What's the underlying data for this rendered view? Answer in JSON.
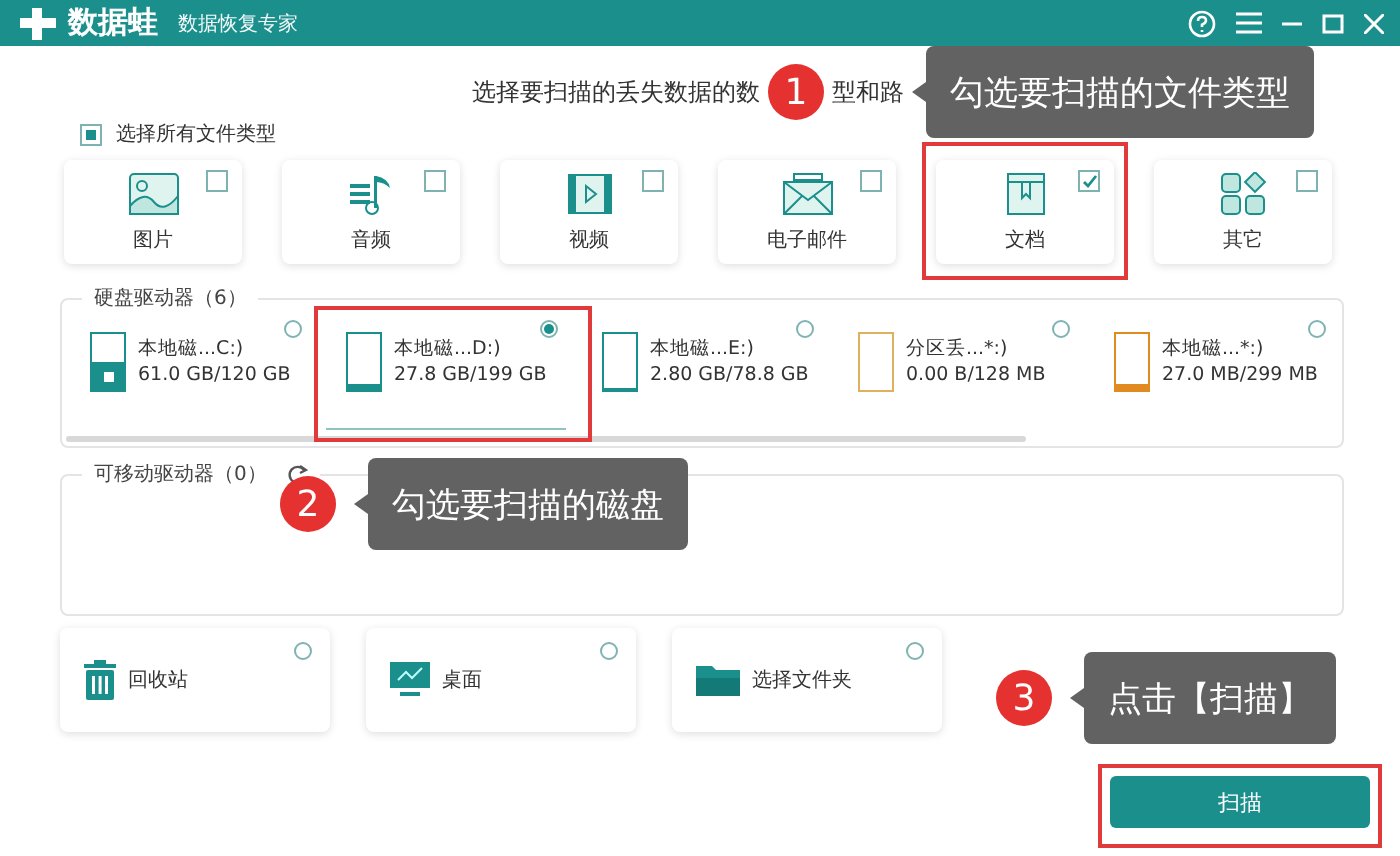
{
  "window": {
    "app_name": "数据蛙",
    "subtitle": "数据恢复专家"
  },
  "heading": "选择要扫描的丢失数据的数",
  "heading_tail": "型和路",
  "select_all": {
    "label": "选择所有文件类型",
    "checked": true
  },
  "file_types": [
    {
      "label": "图片",
      "kind": "image",
      "checked": false
    },
    {
      "label": "音频",
      "kind": "audio",
      "checked": false
    },
    {
      "label": "视频",
      "kind": "video",
      "checked": false
    },
    {
      "label": "电子邮件",
      "kind": "email",
      "checked": false
    },
    {
      "label": "文档",
      "kind": "document",
      "checked": true
    },
    {
      "label": "其它",
      "kind": "other",
      "checked": false
    }
  ],
  "hard_drives": {
    "title": "硬盘驱动器（6）",
    "drives": [
      {
        "name": "本地磁...C:)",
        "usage": "61.0 GB/120 GB",
        "kind": "system",
        "level": 0.5,
        "color": "#1a8f8c",
        "selected": false
      },
      {
        "name": "本地磁...D:)",
        "usage": "27.8 GB/199 GB",
        "kind": "disk",
        "level": 0.12,
        "color": "#1a8f8c",
        "selected": true
      },
      {
        "name": "本地磁...E:)",
        "usage": "2.80 GB/78.8 GB",
        "kind": "disk",
        "level": 0.04,
        "color": "#1a8f8c",
        "selected": false
      },
      {
        "name": "分区丢...*:)",
        "usage": "0.00  B/128 MB",
        "kind": "disk",
        "level": 0,
        "color": "#e0b060",
        "selected": false
      },
      {
        "name": "本地磁...*:)",
        "usage": "27.0 MB/299 MB",
        "kind": "disk",
        "level": 0.12,
        "color": "#e08a20",
        "selected": false
      }
    ]
  },
  "removable_drives": {
    "title": "可移动驱动器（0）"
  },
  "locations": [
    {
      "label": "回收站",
      "kind": "trash",
      "selected": false
    },
    {
      "label": "桌面",
      "kind": "desktop",
      "selected": false
    },
    {
      "label": "选择文件夹",
      "kind": "folder",
      "selected": false
    }
  ],
  "scan_button": "扫描",
  "callouts": [
    {
      "number": "1",
      "text": "勾选要扫描的文件类型"
    },
    {
      "number": "2",
      "text": "勾选要扫描的磁盘"
    },
    {
      "number": "3",
      "text": "点击【扫描】"
    }
  ]
}
